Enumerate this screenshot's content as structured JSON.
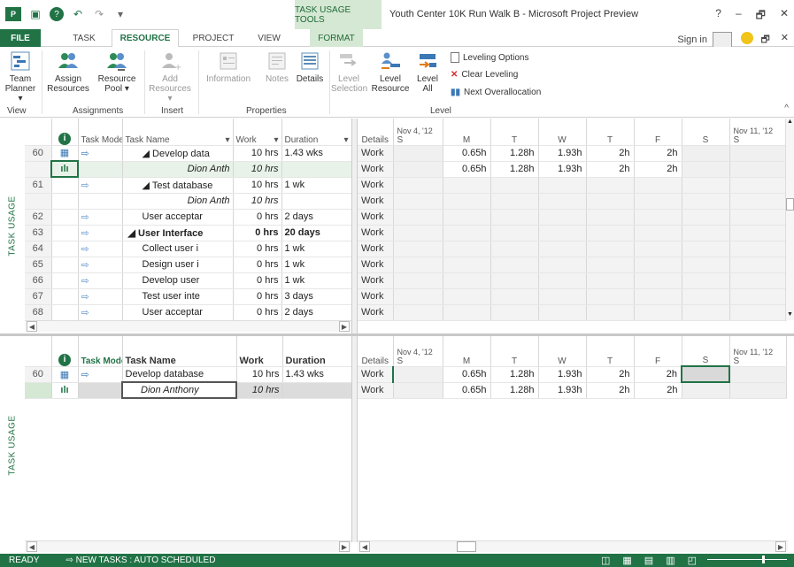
{
  "app": {
    "context_tab": "TASK USAGE TOOLS",
    "window_title": "Youth Center 10K Run Walk B - Microsoft Project Preview",
    "win_buttons": [
      "?",
      "–",
      "🗗",
      "✕"
    ]
  },
  "tabs": [
    "FILE",
    "TASK",
    "RESOURCE",
    "PROJECT",
    "VIEW",
    "FORMAT"
  ],
  "active_tab": "RESOURCE",
  "signin": "Sign in",
  "ribbon": {
    "groups": {
      "view": "View",
      "assignments": "Assignments",
      "insert": "Insert",
      "properties": "Properties",
      "level": "Level"
    },
    "buttons": {
      "team_planner": [
        "Team",
        "Planner ▾"
      ],
      "assign_resources": [
        "Assign",
        "Resources"
      ],
      "resource_pool": [
        "Resource",
        "Pool ▾"
      ],
      "add_resources": [
        "Add",
        "Resources ▾"
      ],
      "information": "Information",
      "notes": "Notes",
      "details": "Details",
      "level_selection": [
        "Level",
        "Selection"
      ],
      "level_resource": [
        "Level",
        "Resource"
      ],
      "level_all": [
        "Level",
        "All"
      ],
      "leveling_options": "Leveling Options",
      "clear_leveling": "Clear Leveling",
      "next_overallocation": "Next Overallocation"
    }
  },
  "top_view": {
    "label": "TASK USAGE",
    "headers": {
      "info": "ⓘ",
      "task_mode": "Task Mode ▾",
      "task_name": "Task Name",
      "work": "Work",
      "duration": "Duration"
    },
    "rows": [
      {
        "id": "60",
        "mode": "▦",
        "name": "◢ Develop data",
        "work": "10 hrs",
        "duration": "1.43 wks",
        "indent": 1,
        "bold": false,
        "italic": false
      },
      {
        "id": "",
        "mode": "",
        "name": "Dion Anth",
        "work": "10 hrs",
        "duration": "",
        "indent": 2,
        "bold": false,
        "italic": true
      },
      {
        "id": "61",
        "mode": "",
        "name": "◢ Test database",
        "work": "10 hrs",
        "duration": "1 wk",
        "indent": 1,
        "bold": false,
        "italic": false
      },
      {
        "id": "",
        "mode": "",
        "name": "Dion Anth",
        "work": "10 hrs",
        "duration": "",
        "indent": 2,
        "bold": false,
        "italic": true
      },
      {
        "id": "62",
        "mode": "",
        "name": "User acceptar",
        "work": "0 hrs",
        "duration": "2 days",
        "indent": 1,
        "bold": false,
        "italic": false
      },
      {
        "id": "63",
        "mode": "",
        "name": "◢ User Interface",
        "work": "0 hrs",
        "duration": "20 days",
        "indent": 0,
        "bold": true,
        "italic": false
      },
      {
        "id": "64",
        "mode": "",
        "name": "Collect user i",
        "work": "0 hrs",
        "duration": "1 wk",
        "indent": 1,
        "bold": false,
        "italic": false
      },
      {
        "id": "65",
        "mode": "",
        "name": "Design user i",
        "work": "0 hrs",
        "duration": "1 wk",
        "indent": 1,
        "bold": false,
        "italic": false
      },
      {
        "id": "66",
        "mode": "",
        "name": "Develop user",
        "work": "0 hrs",
        "duration": "1 wk",
        "indent": 1,
        "bold": false,
        "italic": false
      },
      {
        "id": "67",
        "mode": "",
        "name": "Test user inte",
        "work": "0 hrs",
        "duration": "3 days",
        "indent": 1,
        "bold": false,
        "italic": false
      },
      {
        "id": "68",
        "mode": "",
        "name": "User acceptar",
        "work": "0 hrs",
        "duration": "2 days",
        "indent": 1,
        "bold": false,
        "italic": false
      }
    ],
    "timeline": {
      "week1": "Nov 4, '12",
      "week2": "Nov 11, '12",
      "details_header": "Details",
      "days": [
        "S",
        "M",
        "T",
        "W",
        "T",
        "F",
        "S",
        "S"
      ],
      "rows": [
        {
          "detail": "Work",
          "values": [
            "",
            "0.65h",
            "1.28h",
            "1.93h",
            "2h",
            "2h",
            "",
            ""
          ]
        },
        {
          "detail": "Work",
          "values": [
            "",
            "0.65h",
            "1.28h",
            "1.93h",
            "2h",
            "2h",
            "",
            ""
          ]
        },
        {
          "detail": "Work",
          "values": [
            "",
            "",
            "",
            "",
            "",
            "",
            "",
            ""
          ]
        },
        {
          "detail": "Work",
          "values": [
            "",
            "",
            "",
            "",
            "",
            "",
            "",
            ""
          ]
        },
        {
          "detail": "Work",
          "values": [
            "",
            "",
            "",
            "",
            "",
            "",
            "",
            ""
          ]
        },
        {
          "detail": "Work",
          "values": [
            "",
            "",
            "",
            "",
            "",
            "",
            "",
            ""
          ]
        },
        {
          "detail": "Work",
          "values": [
            "",
            "",
            "",
            "",
            "",
            "",
            "",
            ""
          ]
        },
        {
          "detail": "Work",
          "values": [
            "",
            "",
            "",
            "",
            "",
            "",
            "",
            ""
          ]
        },
        {
          "detail": "Work",
          "values": [
            "",
            "",
            "",
            "",
            "",
            "",
            "",
            ""
          ]
        },
        {
          "detail": "Work",
          "values": [
            "",
            "",
            "",
            "",
            "",
            "",
            "",
            ""
          ]
        },
        {
          "detail": "Work",
          "values": [
            "",
            "",
            "",
            "",
            "",
            "",
            "",
            ""
          ]
        }
      ]
    }
  },
  "bottom_view": {
    "label": "TASK USAGE",
    "headers": {
      "info": "ⓘ",
      "task_mode": "Task Mode",
      "task_name": "Task Name",
      "work": "Work",
      "duration": "Duration"
    },
    "rows": [
      {
        "id": "60",
        "name": "Develop database",
        "work": "10 hrs",
        "duration": "1.43 wks",
        "italic": false
      },
      {
        "id": "",
        "name": "Dion Anthony",
        "work": "10 hrs",
        "duration": "",
        "italic": true
      }
    ],
    "timeline": {
      "week1": "Nov 4, '12",
      "week2": "Nov 11, '12",
      "details_header": "Details",
      "days": [
        "S",
        "M",
        "T",
        "W",
        "T",
        "F",
        "S",
        "S"
      ],
      "rows": [
        {
          "detail": "Work",
          "values": [
            "",
            "0.65h",
            "1.28h",
            "1.93h",
            "2h",
            "2h",
            "",
            ""
          ]
        },
        {
          "detail": "Work",
          "values": [
            "",
            "0.65h",
            "1.28h",
            "1.93h",
            "2h",
            "2h",
            "",
            ""
          ]
        }
      ]
    }
  },
  "status": {
    "ready": "READY",
    "new_tasks": "NEW TASKS : AUTO SCHEDULED"
  },
  "colors": {
    "accent": "#217346",
    "context": "#d5e8d4"
  }
}
